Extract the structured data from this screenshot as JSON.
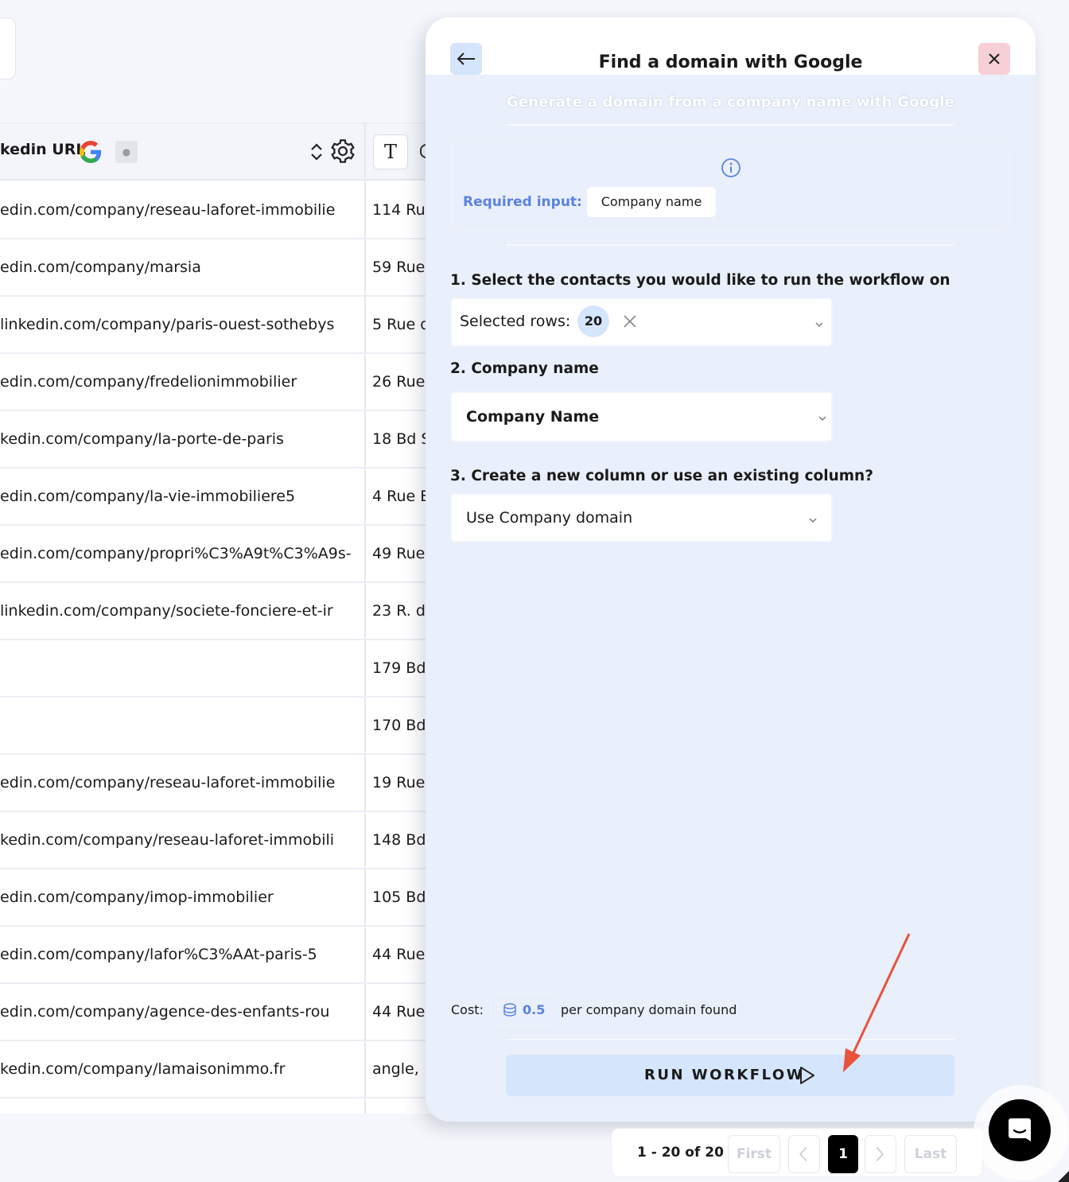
{
  "table": {
    "header_title": "kedin URL",
    "t_button": "T",
    "rows": [
      {
        "url": "edin.com/company/reseau-laforet-immobilie",
        "address": "114 Rue"
      },
      {
        "url": "edin.com/company/marsia",
        "address": "59 Rue"
      },
      {
        "url": "linkedin.com/company/paris-ouest-sothebys",
        "address": "5 Rue d"
      },
      {
        "url": "edin.com/company/fredelionimmobilier",
        "address": "26 Rue"
      },
      {
        "url": "kedin.com/company/la-porte-de-paris",
        "address": "18 Bd S"
      },
      {
        "url": "edin.com/company/la-vie-immobiliere5",
        "address": "4 Rue E"
      },
      {
        "url": "edin.com/company/propri%C3%A9t%C3%A9s-",
        "address": "49 Rue"
      },
      {
        "url": "linkedin.com/company/societe-fonciere-et-ir",
        "address": "23 R. de"
      },
      {
        "url": "",
        "address": "179 Bd"
      },
      {
        "url": "",
        "address": "170 Bd"
      },
      {
        "url": "edin.com/company/reseau-laforet-immobilie",
        "address": "19 Rue"
      },
      {
        "url": "kedin.com/company/reseau-laforet-immobili",
        "address": "148 Bd"
      },
      {
        "url": "edin.com/company/imop-immobilier",
        "address": "105 Bd"
      },
      {
        "url": "edin.com/company/lafor%C3%AAt-paris-5",
        "address": "44 Rue"
      },
      {
        "url": "edin.com/company/agence-des-enfants-rou",
        "address": "44 Rue"
      },
      {
        "url": "kedin.com/company/lamaisonimmo.fr",
        "address": "angle,"
      }
    ]
  },
  "panel": {
    "title": "Find a domain with Google",
    "subtitle": "Generate a domain from a company name with Google",
    "required_label": "Required input:",
    "required_value": "Company name",
    "step1_label": "1. Select the contacts you would like to run the workflow on",
    "step1_text": "Selected rows:",
    "step1_count": "20",
    "step2_label": "2. Company name",
    "step2_value": "Company Name",
    "step3_label": "3. Create a new column or use an existing column?",
    "step3_value": "Use Company domain",
    "cost_label": "Cost:",
    "cost_value": "0.5",
    "cost_suffix": "per company domain found",
    "run_label": "RUN WORKFLOW"
  },
  "pagination": {
    "range": "1 - 20 of 20",
    "first": "First",
    "page": "1",
    "last": "Last"
  },
  "colors": {
    "accent": "#5a82e2",
    "panel_bg": "#e9effb",
    "button_bg": "#d5e5fb",
    "close_bg": "#f7cfd6",
    "arrow": "#e8533c"
  }
}
